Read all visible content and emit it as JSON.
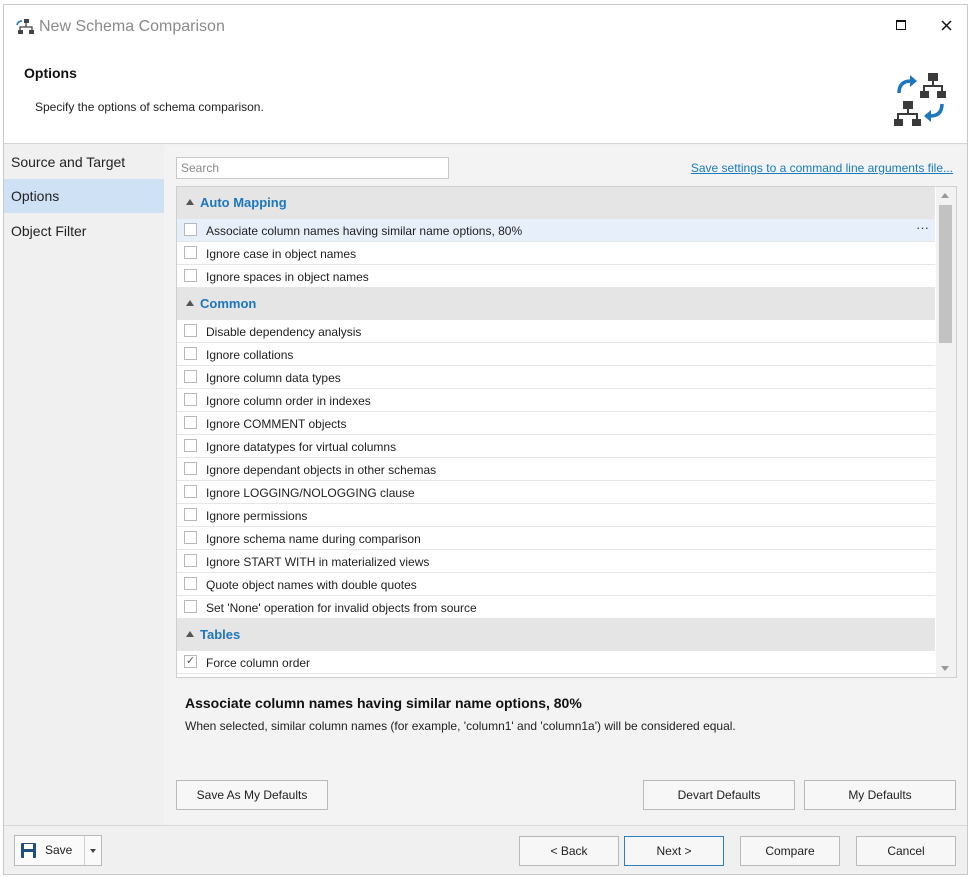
{
  "window": {
    "title": "New Schema Comparison",
    "maximize_icon": "maximize-icon",
    "close_icon": "close-icon"
  },
  "header": {
    "title": "Options",
    "description": "Specify the options of schema comparison."
  },
  "nav": {
    "items": [
      {
        "label": "Source and Target",
        "active": false
      },
      {
        "label": "Options",
        "active": true
      },
      {
        "label": "Object Filter",
        "active": false
      }
    ]
  },
  "search": {
    "placeholder": "Search",
    "value": ""
  },
  "save_settings_link": "Save settings to a command line arguments file...",
  "groups": [
    {
      "label": "Auto Mapping",
      "options": [
        {
          "label": "Associate column names having similar name options, 80%",
          "checked": false,
          "selected": true
        },
        {
          "label": "Ignore case in object names",
          "checked": false
        },
        {
          "label": "Ignore spaces in object names",
          "checked": false
        }
      ]
    },
    {
      "label": "Common",
      "options": [
        {
          "label": "Disable dependency analysis",
          "checked": false
        },
        {
          "label": "Ignore collations",
          "checked": false
        },
        {
          "label": "Ignore column data types",
          "checked": false
        },
        {
          "label": "Ignore column order in indexes",
          "checked": false
        },
        {
          "label": "Ignore COMMENT objects",
          "checked": false
        },
        {
          "label": "Ignore datatypes for virtual columns",
          "checked": false
        },
        {
          "label": "Ignore dependant objects in other schemas",
          "checked": false
        },
        {
          "label": "Ignore LOGGING/NOLOGGING clause",
          "checked": false
        },
        {
          "label": "Ignore permissions",
          "checked": false
        },
        {
          "label": "Ignore schema name during comparison",
          "checked": false
        },
        {
          "label": "Ignore START WITH in materialized views",
          "checked": false
        },
        {
          "label": "Quote object names with double quotes",
          "checked": false
        },
        {
          "label": "Set 'None' operation for invalid objects from source",
          "checked": false
        }
      ]
    },
    {
      "label": "Tables",
      "options": [
        {
          "label": "Force column order",
          "checked": true
        }
      ]
    }
  ],
  "description": {
    "title": "Associate column names having similar name options, 80%",
    "text": "When selected, similar column names (for example, 'column1' and 'column1a') will be considered equal."
  },
  "buttons": {
    "save_as_defaults": "Save As My Defaults",
    "devart_defaults": "Devart Defaults",
    "my_defaults": "My Defaults",
    "save": "Save",
    "back": "< Back",
    "next": "Next >",
    "compare": "Compare",
    "cancel": "Cancel"
  },
  "colors": {
    "accent": "#1d77bd",
    "nav_active": "#cfe2f5",
    "group_bg": "#e5e5e5",
    "selected_row": "#e6effa"
  }
}
